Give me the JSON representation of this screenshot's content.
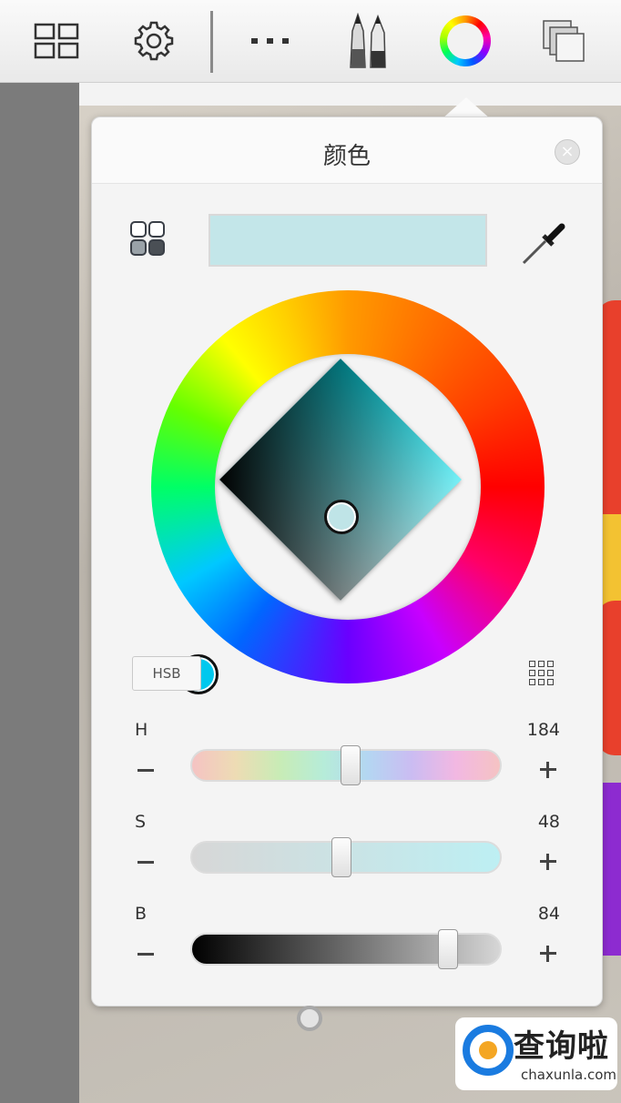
{
  "toolbar": {
    "icons": [
      "layout-grid-icon",
      "settings-gear-icon",
      "more-dots-icon",
      "brush-tools-icon",
      "color-wheel-icon",
      "layers-icon"
    ]
  },
  "panel": {
    "title": "颜色",
    "close_symbol": "×",
    "current_color": "#c3e6e9",
    "mode_label": "HSB"
  },
  "sliders": [
    {
      "label": "H",
      "value": "184",
      "position": 0.5
    },
    {
      "label": "S",
      "value": "48",
      "position": 0.48
    },
    {
      "label": "B",
      "value": "84",
      "position": 0.84
    }
  ],
  "watermark": {
    "title": "查询啦",
    "url": "chaxunla.com"
  }
}
